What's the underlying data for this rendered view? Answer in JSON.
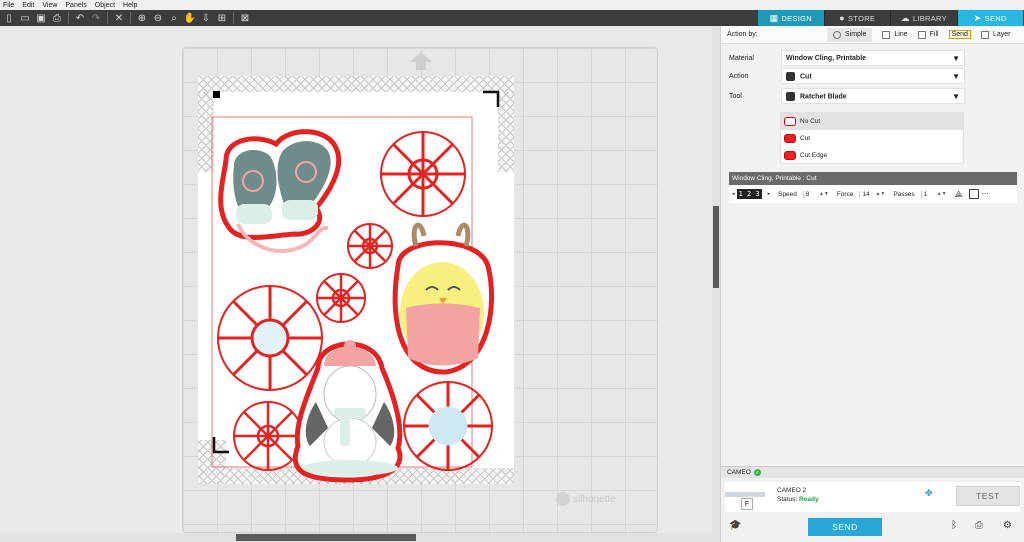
{
  "menu": [
    "File",
    "Edit",
    "View",
    "Panels",
    "Object",
    "Help"
  ],
  "tabs": [
    {
      "label": "DESIGN",
      "icon": "grid-icon"
    },
    {
      "label": "STORE",
      "icon": "store-icon"
    },
    {
      "label": "LIBRARY",
      "icon": "cloud-icon"
    },
    {
      "label": "SEND",
      "icon": "send-icon"
    }
  ],
  "watermark": "silhouette",
  "panel": {
    "action_by": "Action by:",
    "options": [
      "Simple",
      "Line",
      "Fill",
      "Send",
      "Layer"
    ],
    "material_label": "Material",
    "material_value": "Window Cling, Printable",
    "action_label": "Action",
    "action_value": "Cut",
    "tool_label": "Tool",
    "tool_value": "Ratchet Blade",
    "cut_options": [
      "No Cut",
      "Cut",
      "Cut Edge"
    ],
    "summary_title": "Window Cling, Printable : Cut",
    "digits": "1 2 3",
    "speed_label": "Speed",
    "speed_value": "8",
    "force_label": "Force",
    "force_value": "14",
    "passes_label": "Passes",
    "passes_value": "1"
  },
  "device": {
    "header": "CAMEO",
    "name": "CAMEO 2",
    "status_label": "Status:",
    "status_value": "Ready",
    "test_label": "TEST",
    "send_label": "SEND"
  },
  "colors": {
    "accent": "#29b7e2",
    "cut_line": "#e52222",
    "mitten": "#6f8c8c",
    "owl": "#f7ef80",
    "scarf": "#f4a3a3"
  }
}
